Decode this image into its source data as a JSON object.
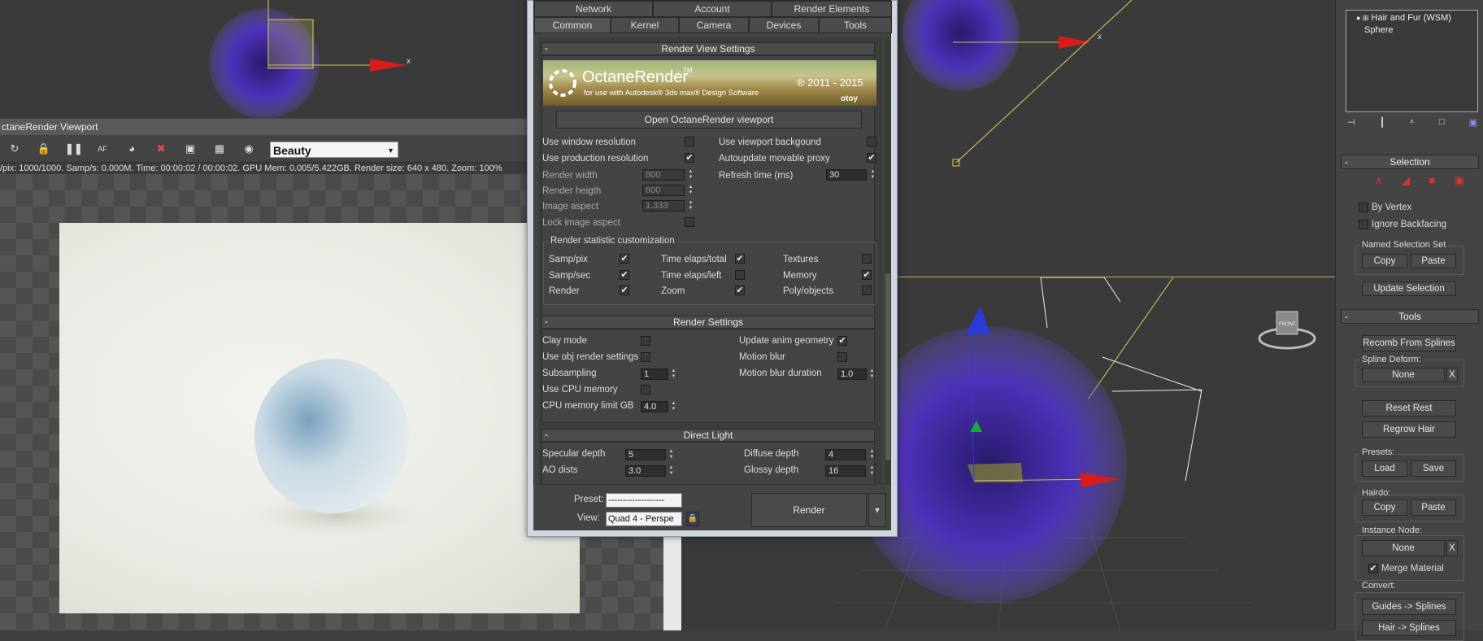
{
  "octane_viewport": {
    "title": "ctaneRender Viewport",
    "view_pass": "Beauty",
    "status": "/pix: 1000/1000.   Samp/s: 0.000M.   Time: 00:00:02 / 00:00:02.   GPU Mem: 0.005/5.422GB.   Render size: 640 x 480.   Zoom: 100%"
  },
  "dialog": {
    "tabs_row1": [
      "Network",
      "Account",
      "Render Elements"
    ],
    "tabs_row2": [
      "Common",
      "Kernel",
      "Camera",
      "Devices",
      "Tools"
    ],
    "render_view_settings": {
      "header": "Render View Settings",
      "banner_title": "OctaneRender",
      "banner_tm": "TM",
      "banner_sub": "for use with Autodesk® 3ds max® Design Software",
      "banner_years": "® 2011 - 2015",
      "banner_brand": "otoy",
      "open_viewport_button": "Open OctaneRender viewport",
      "use_window_resolution": "Use window resolution",
      "use_production_resolution": "Use production resolution",
      "render_width": "Render width",
      "render_width_val": "800",
      "render_height": "Render heigth",
      "render_height_val": "600",
      "image_aspect": "Image aspect",
      "image_aspect_val": "1.333",
      "lock_image_aspect": "Lock image aspect",
      "use_viewport_background": "Use viewport backgound",
      "autoupdate_proxy": "Autoupdate movable proxy",
      "refresh_time": "Refresh time (ms)",
      "refresh_time_val": "30",
      "stat_group": "Render statistic customization",
      "samp_pix": "Samp/pix",
      "samp_sec": "Samp/sec",
      "render": "Render",
      "time_total": "Time elaps/total",
      "time_left": "Time elaps/left",
      "zoom": "Zoom",
      "textures": "Textures",
      "memory": "Memory",
      "poly_objects": "Poly/objects"
    },
    "render_settings": {
      "header": "Render Settings",
      "clay_mode": "Clay mode",
      "use_obj_render": "Use obj render settings",
      "subsampling": "Subsampling",
      "subsampling_val": "1",
      "use_cpu_memory": "Use CPU memory",
      "cpu_mem_limit": "CPU memory limit GB",
      "cpu_mem_limit_val": "4.0",
      "update_anim": "Update anim geometry",
      "motion_blur": "Motion blur",
      "motion_blur_duration": "Motion blur duration",
      "motion_blur_duration_val": "1.0"
    },
    "direct_light": {
      "header": "Direct Light",
      "specular_depth": "Specular depth",
      "specular_depth_val": "5",
      "ao_dists": "AO dists",
      "ao_dists_val": "3.0",
      "diffuse_depth": "Diffuse depth",
      "diffuse_depth_val": "4",
      "glossy_depth": "Glossy depth",
      "glossy_depth_val": "16"
    },
    "bottom": {
      "preset_label": "Preset:",
      "preset_val": "-------------------",
      "view_label": "View:",
      "view_val": "Quad 4 - Perspe",
      "render_button": "Render"
    }
  },
  "command_panel": {
    "modifier_stack": [
      "Hair and Fur (WSM)",
      "Sphere"
    ],
    "selection": {
      "header": "Selection",
      "by_vertex": "By Vertex",
      "ignore_backfacing": "Ignore Backfacing",
      "named_selection_set": "Named Selection Set",
      "copy": "Copy",
      "paste": "Paste",
      "update_selection": "Update Selection"
    },
    "tools": {
      "header": "Tools",
      "recomb": "Recomb From Splines",
      "spline_deform": "Spline Deform:",
      "none": "None",
      "x": "X",
      "reset_rest": "Reset Rest",
      "regrow_hair": "Regrow Hair",
      "presets": "Presets:",
      "load": "Load",
      "save": "Save",
      "hairdo": "Hairdo:",
      "copy": "Copy",
      "paste": "Paste",
      "instance_node": "Instance Node:",
      "merge_material": "Merge Material",
      "convert": "Convert:",
      "guides_splines": "Guides -> Splines",
      "hair_splines": "Hair -> Splines"
    }
  },
  "viewport_labels": {
    "axis_x": "x",
    "axis_y": "y",
    "cube_label": "FRONT"
  }
}
